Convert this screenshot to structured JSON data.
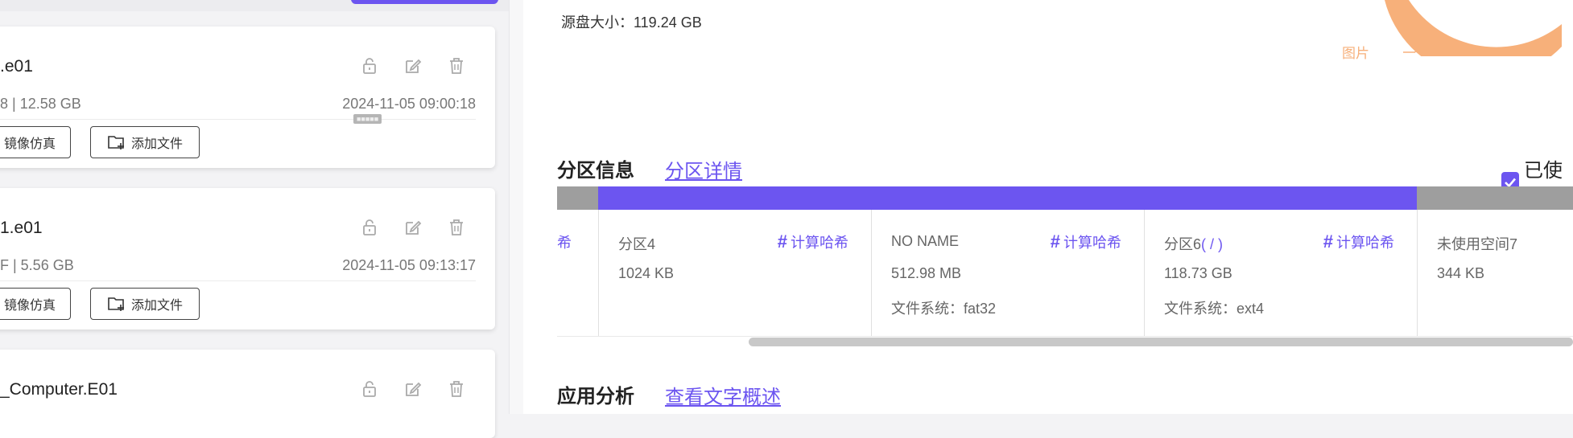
{
  "cards": [
    {
      "name": ".e01",
      "meta": "8 | 12.58 GB",
      "date": "2024-11-05 09:00:18",
      "btn_emulate": "镜像仿真",
      "btn_add": "添加文件",
      "tooltip": "■■■■■"
    },
    {
      "name": "1.e01",
      "meta": "F | 5.56 GB",
      "date": "2024-11-05 09:13:17",
      "btn_emulate": "镜像仿真",
      "btn_add": "添加文件"
    },
    {
      "name": "_Computer.E01"
    }
  ],
  "right": {
    "source_size": "源盘大小：119.24 GB",
    "donut_label": "图片",
    "partition_title": "分区信息",
    "partition_link": "分区详情",
    "used_checkbox_label": "已使用",
    "app_title": "应用分析",
    "app_link": "查看文字概述",
    "colors": {
      "accent": "#6c55f0",
      "unused": "#9e9e9e",
      "donut": "#f7b07a"
    },
    "partitions": [
      {
        "partial": "希"
      },
      {
        "name": "分区4",
        "size": "1024 KB",
        "fs": "",
        "hash": "计算哈希",
        "used": true
      },
      {
        "name": "NO NAME",
        "size": "512.98 MB",
        "fs": "文件系统：fat32",
        "hash": "计算哈希",
        "used": true
      },
      {
        "name": "分区6",
        "name_suffix": "( / )",
        "size": "118.73 GB",
        "fs": "文件系统：ext4",
        "hash": "计算哈希",
        "used": true
      },
      {
        "name": "未使用空间7",
        "size": "344 KB",
        "used": false
      }
    ]
  }
}
